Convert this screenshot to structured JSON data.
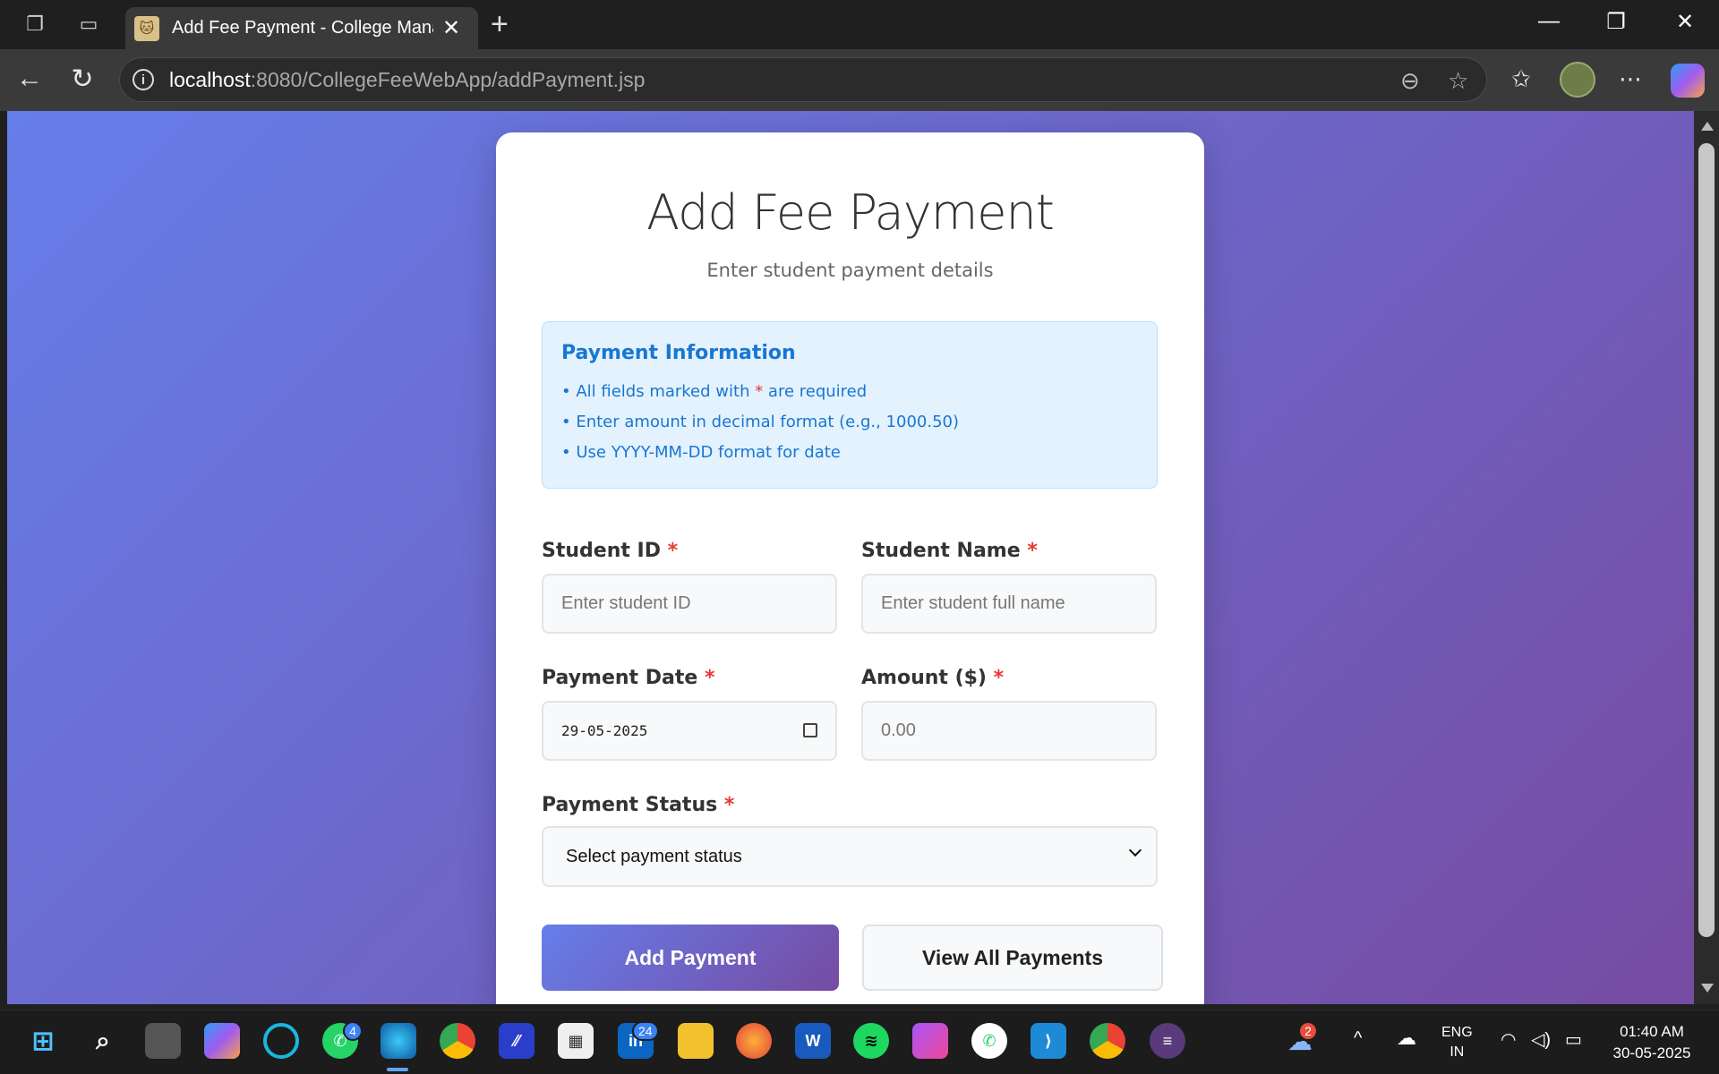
{
  "browser": {
    "tab_title": "Add Fee Payment - College Mana",
    "tab_favicon": "tomcat-icon",
    "address_host": "localhost",
    "address_path": ":8080/CollegeFeeWebApp/addPayment.jsp"
  },
  "page": {
    "title": "Add Fee Payment",
    "subtitle": "Enter student payment details",
    "info_box": {
      "heading": "Payment Information",
      "item1_before": "• All fields marked with ",
      "item1_star": "*",
      "item1_after": " are required",
      "item2": "• Enter amount in decimal format (e.g., 1000.50)",
      "item3": "• Use YYYY-MM-DD format for date"
    },
    "fields": {
      "student_id": {
        "label": "Student ID",
        "required": "*",
        "placeholder": "Enter student ID"
      },
      "student_name": {
        "label": "Student Name",
        "required": "*",
        "placeholder": "Enter student full name"
      },
      "payment_date": {
        "label": "Payment Date",
        "required": "*",
        "value": "29-05-2025"
      },
      "amount": {
        "label": "Amount ($)",
        "required": "*",
        "placeholder": "0.00"
      },
      "payment_status": {
        "label": "Payment Status",
        "required": "*",
        "selected": "Select payment status"
      }
    },
    "buttons": {
      "add": "Add Payment",
      "view_all": "View All Payments"
    }
  },
  "taskbar": {
    "whatsapp_badge": "4",
    "linkedin_badge": "24",
    "weather_badge": "2",
    "lang_line1": "ENG",
    "lang_line2": "IN",
    "time": "01:40 AM",
    "date": "30-05-2025"
  },
  "colors": {
    "gradient_start": "#667eea",
    "gradient_end": "#764ba2",
    "info_text": "#1976d2",
    "required_star": "#e53935"
  }
}
